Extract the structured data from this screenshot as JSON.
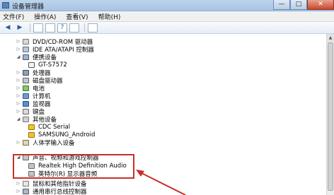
{
  "window": {
    "title": "设备管理器",
    "buttons": {
      "minimize": "—",
      "maximize": "□",
      "close": "✕"
    }
  },
  "menu": [
    "文件(F)",
    "操作(A)",
    "查看(V)",
    "帮助(H)"
  ],
  "tree": [
    {
      "label": "DVD/CD-ROM 驱动器",
      "icon": "dvd-drive-icon",
      "expander": "collapsed"
    },
    {
      "label": "IDE ATA/ATAPI 控制器",
      "icon": "ide-controller-icon",
      "expander": "collapsed"
    },
    {
      "label": "便携设备",
      "icon": "portable-device-icon",
      "expander": "expanded"
    },
    {
      "label": "GT-S7572",
      "icon": "phone-icon",
      "expander": "none"
    },
    {
      "label": "处理器",
      "icon": "cpu-icon",
      "expander": "collapsed"
    },
    {
      "label": "磁盘驱动器",
      "icon": "disk-drive-icon",
      "expander": "collapsed"
    },
    {
      "label": "电池",
      "icon": "battery-icon",
      "expander": "collapsed"
    },
    {
      "label": "计算机",
      "icon": "computer-icon",
      "expander": "collapsed"
    },
    {
      "label": "监视器",
      "icon": "monitor-icon",
      "expander": "collapsed"
    },
    {
      "label": "键盘",
      "icon": "keyboard-icon",
      "expander": "collapsed"
    },
    {
      "label": "其他设备",
      "icon": "other-devices-icon",
      "expander": "expanded"
    },
    {
      "label": "CDC Serial",
      "icon": "warning-device-icon",
      "expander": "none"
    },
    {
      "label": "SAMSUNG_Android",
      "icon": "warning-device-icon",
      "expander": "none"
    },
    {
      "label": "人体学输入设备",
      "icon": "hid-icon",
      "expander": "collapsed"
    },
    {
      "label": "声音、视频和游戏控制器",
      "icon": "sound-controller-icon",
      "expander": "expanded"
    },
    {
      "label": "Realtek High Definition Audio",
      "icon": "audio-device-icon",
      "expander": "none"
    },
    {
      "label": "英特尔(R) 显示器音频",
      "icon": "audio-device-icon",
      "expander": "none"
    },
    {
      "label": "鼠标和其他指针设备",
      "icon": "mouse-icon",
      "expander": "collapsed"
    },
    {
      "label": "通用串行总线控制器",
      "icon": "usb-controller-icon",
      "expander": "collapsed"
    }
  ],
  "annotation": {
    "color": "#c8302a"
  }
}
